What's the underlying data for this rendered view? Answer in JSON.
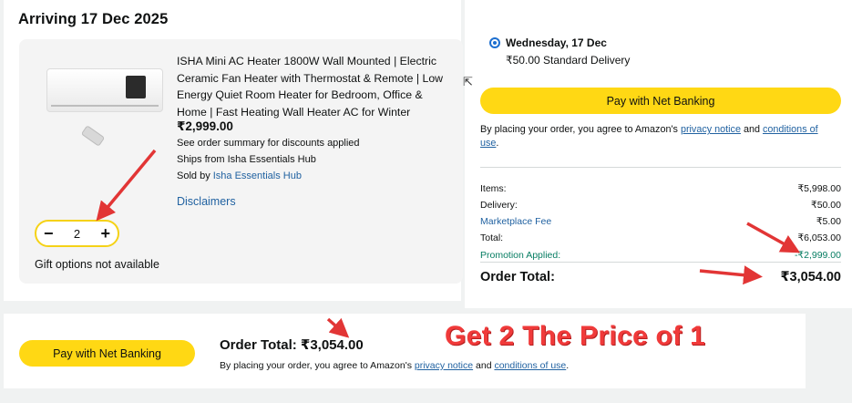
{
  "arriving": "Arriving 17 Dec 2025",
  "product": {
    "title": "ISHA Mini AC Heater 1800W Wall Mounted | Electric Ceramic Fan Heater with Thermostat & Remote | Low Energy Quiet Room Heater for Bedroom, Office & Home | Fast Heating Wall Heater AC for Winter",
    "price": "₹2,999.00",
    "summary_note": "See order summary for discounts applied",
    "ships_from": "Ships from Isha Essentials Hub",
    "sold_by_label": "Sold by ",
    "seller": "Isha Essentials Hub",
    "disclaimers": "Disclaimers",
    "quantity": "2",
    "minus": "−",
    "plus": "+",
    "gift": "Gift options not available"
  },
  "delivery": {
    "day": "Wednesday, 17 Dec",
    "option": "₹50.00 Standard Delivery"
  },
  "pay_button": "Pay with Net Banking",
  "agreement": {
    "prefix": "By placing your order, you agree to Amazon's ",
    "privacy": "privacy notice",
    "and": " and ",
    "conditions": "conditions of use",
    "suffix": "."
  },
  "summary": {
    "items_label": "Items:",
    "items_value": "₹5,998.00",
    "delivery_label": "Delivery:",
    "delivery_value": "₹50.00",
    "fee_label": "Marketplace Fee",
    "fee_value": "₹5.00",
    "total_label": "Total:",
    "total_value": "₹6,053.00",
    "promo_label": "Promotion Applied:",
    "promo_value": "-₹2,999.00",
    "order_total_label": "Order Total:",
    "order_total_value": "₹3,054.00"
  },
  "bottom": {
    "order_total": "Order Total: ₹3,054.00"
  },
  "annotation": "Get 2 The Price of 1",
  "colors": {
    "button": "#ffd814",
    "link": "#2162a1",
    "promo": "#067d62",
    "annotation": "#f03a3a"
  }
}
